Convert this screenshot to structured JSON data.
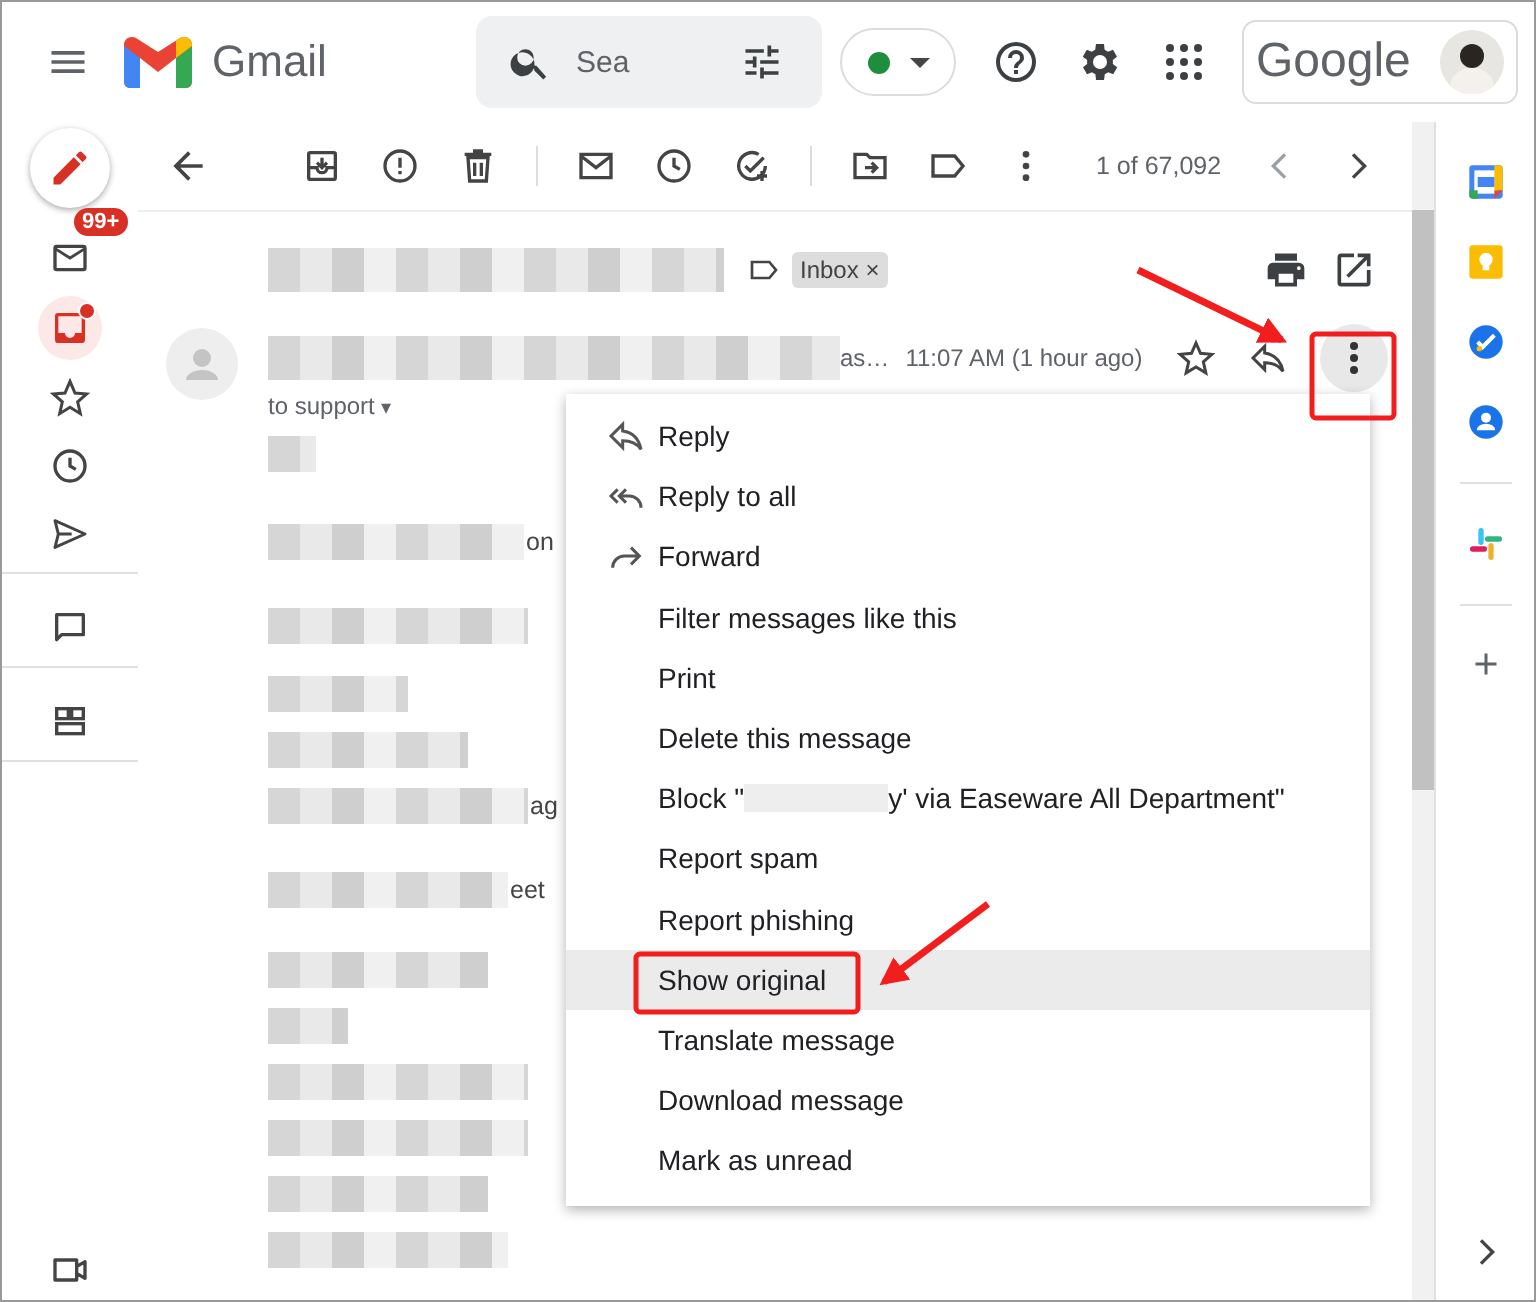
{
  "header": {
    "app_name": "Gmail",
    "search": {
      "placeholder": "Sea"
    },
    "status": {
      "color": "#1e8e3e"
    },
    "account_brand": "Google"
  },
  "left_rail": {
    "items": [
      {
        "kind": "mail",
        "badge": "99+",
        "selected": false,
        "dot": false
      },
      {
        "kind": "inbox",
        "selected": true,
        "dot": true
      },
      {
        "kind": "star",
        "selected": false,
        "dot": false
      },
      {
        "kind": "clock",
        "selected": false,
        "dot": false
      },
      {
        "kind": "send",
        "selected": false,
        "dot": false
      },
      {
        "kind": "chat",
        "selected": false,
        "dot": false
      },
      {
        "kind": "spaces",
        "selected": false,
        "dot": false
      },
      {
        "kind": "meet",
        "selected": false,
        "dot": false
      }
    ]
  },
  "toolbar": {
    "counter": "1 of 67,092"
  },
  "message": {
    "label": "Inbox",
    "label_close": "×",
    "recipient_caret": "▾",
    "sender_tail": "as…",
    "time": "11:07 AM (1 hour ago)",
    "recipient": "to support",
    "body_fragments": [
      "on",
      "ag",
      "eet"
    ]
  },
  "menu": {
    "items": [
      {
        "kind": "reply",
        "label": "Reply",
        "selected": false
      },
      {
        "kind": "reply_all",
        "label": "Reply to all",
        "selected": false
      },
      {
        "kind": "forward",
        "label": "Forward",
        "selected": false
      },
      {
        "kind": "plain",
        "label": "Filter messages like this",
        "selected": false
      },
      {
        "kind": "plain",
        "label": "Print",
        "selected": false
      },
      {
        "kind": "plain",
        "label": "Delete this message",
        "selected": false
      },
      {
        "kind": "redacted",
        "label": "Block \"",
        "label_after": "y' via Easeware All Department\"",
        "selected": false
      },
      {
        "kind": "plain",
        "label": "Report spam",
        "selected": false
      },
      {
        "kind": "plain",
        "label": "Report phishing",
        "selected": false
      },
      {
        "kind": "plain",
        "label": "Show original",
        "selected": true
      },
      {
        "kind": "plain",
        "label": "Translate message",
        "selected": false
      },
      {
        "kind": "plain",
        "label": "Download message",
        "selected": false
      },
      {
        "kind": "plain",
        "label": "Mark as unread",
        "selected": false
      }
    ]
  },
  "right_panel": {
    "apps": [
      {
        "kind": "calendar"
      },
      {
        "kind": "keep"
      },
      {
        "kind": "tasks"
      },
      {
        "kind": "contacts"
      },
      {
        "kind": "slack"
      },
      {
        "kind": "add"
      }
    ]
  }
}
